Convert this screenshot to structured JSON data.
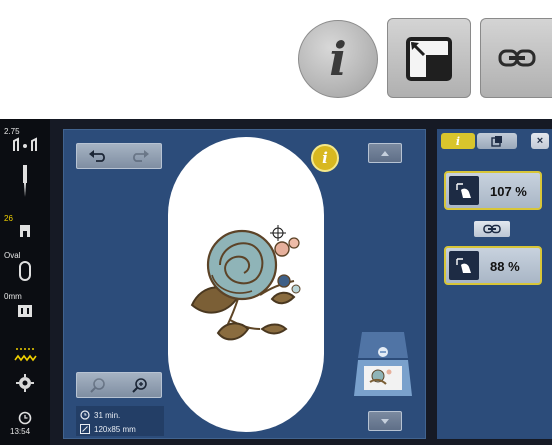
{
  "toolbar": {
    "info_glyph": "i",
    "info_button": "info-icon",
    "resize_button": "resize-icon",
    "link_button": "chain-link-icon"
  },
  "status_bar": {
    "needle_size": "2.75",
    "presser_foot": "26",
    "hoop_name": "Oval",
    "offset": "0mm",
    "time": "13:54"
  },
  "stage": {
    "undo_icon": "undo-icon",
    "info_badge": "i",
    "zoom_icon": "zoom-in-icon",
    "stitch_time": "31 min.",
    "design_size": "120x85 mm"
  },
  "side_panel": {
    "tab_info": "i",
    "close_label": "×",
    "width_percent": "107 %",
    "height_percent": "88 %"
  },
  "colors": {
    "accent_yellow": "#e8d22e",
    "panel_blue": "#2c4c7a",
    "screen_dark": "#161a25"
  }
}
